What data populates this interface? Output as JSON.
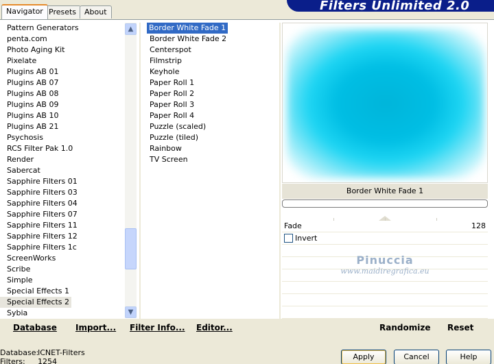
{
  "banner_title": "Filters Unlimited 2.0",
  "tabs": [
    "Navigator",
    "Presets",
    "About"
  ],
  "categories": [
    "Pattern Generators",
    "penta.com",
    "Photo Aging Kit",
    "Pixelate",
    "Plugins AB 01",
    "Plugins AB 07",
    "Plugins AB 08",
    "Plugins AB 09",
    "Plugins AB 10",
    "Plugins AB 21",
    "Psychosis",
    "RCS Filter Pak 1.0",
    "Render",
    "Sabercat",
    "Sapphire Filters 01",
    "Sapphire Filters 03",
    "Sapphire Filters 04",
    "Sapphire Filters 07",
    "Sapphire Filters 11",
    "Sapphire Filters 12",
    "Sapphire Filters 1c",
    "ScreenWorks",
    "Scribe",
    "Simple",
    "Special Effects 1",
    "Special Effects 2",
    "Sybia"
  ],
  "selected_category": "Special Effects 2",
  "filters": [
    "Border White Fade 1",
    "Border White Fade 2",
    "Centerspot",
    "Filmstrip",
    "Keyhole",
    "Paper Roll 1",
    "Paper Roll 2",
    "Paper Roll 3",
    "Paper Roll 4",
    "Puzzle (scaled)",
    "Puzzle (tiled)",
    "Rainbow",
    "TV Screen"
  ],
  "selected_filter": "Border White Fade 1",
  "preview_filter_name": "Border White Fade 1",
  "params": {
    "fade_label": "Fade",
    "fade_value": "128",
    "fade_level": 0.5,
    "invert_label": "Invert",
    "invert_checked": false
  },
  "watermark": {
    "name": "Pinuccia",
    "url": "www.maidiregrafica.eu"
  },
  "buttons": {
    "database": "Database",
    "import": "Import...",
    "filter_info": "Filter Info...",
    "editor": "Editor...",
    "randomize": "Randomize",
    "reset": "Reset",
    "apply": "Apply",
    "cancel": "Cancel",
    "help": "Help"
  },
  "status": {
    "database_label": "Database:",
    "database_value": "ICNET-Filters",
    "filters_label": "Filters:",
    "filters_value": "1254"
  },
  "scroll_icons": {
    "up": "chevron-up-icon",
    "down": "chevron-down-icon"
  },
  "colors": {
    "banner": "#0a1e8a",
    "selection": "#316ac5",
    "preview_center": "#00b5da",
    "preview_edge": "#7ee6f7"
  }
}
